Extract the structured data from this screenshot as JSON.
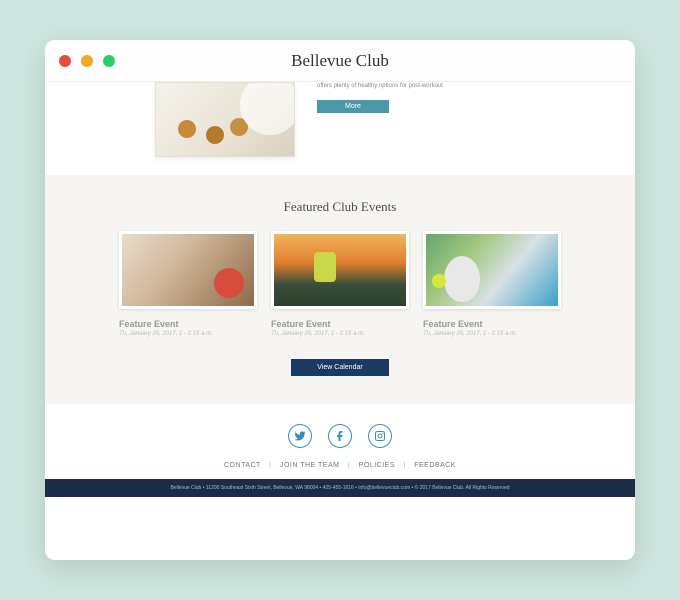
{
  "window": {
    "title": "Bellevue Club"
  },
  "article": {
    "desc": "offers plenty of healthy options for post-workout",
    "more_label": "More"
  },
  "events": {
    "heading": "Featured Club Events",
    "items": [
      {
        "title": "Feature Event",
        "date": "Th, January 26, 2017, 1 - 2:15 a.m."
      },
      {
        "title": "Feature Event",
        "date": "Th, January 26, 2017, 1 - 2:15 a.m."
      },
      {
        "title": "Feature Event",
        "date": "Th, January 26, 2017, 1 - 2:15 a.m."
      }
    ],
    "calendar_label": "View Calendar"
  },
  "footer": {
    "links": [
      "CONTACT",
      "JOIN THE TEAM",
      "POLICIES",
      "FEEDBACK"
    ],
    "legal": "Bellevue Club  •  11200 Southeast Sixth Street, Bellevue, WA 98004  •  425-455-1616  •  info@bellevueclub.com  •  © 2017 Bellevue Club. All Rights Reserved"
  }
}
